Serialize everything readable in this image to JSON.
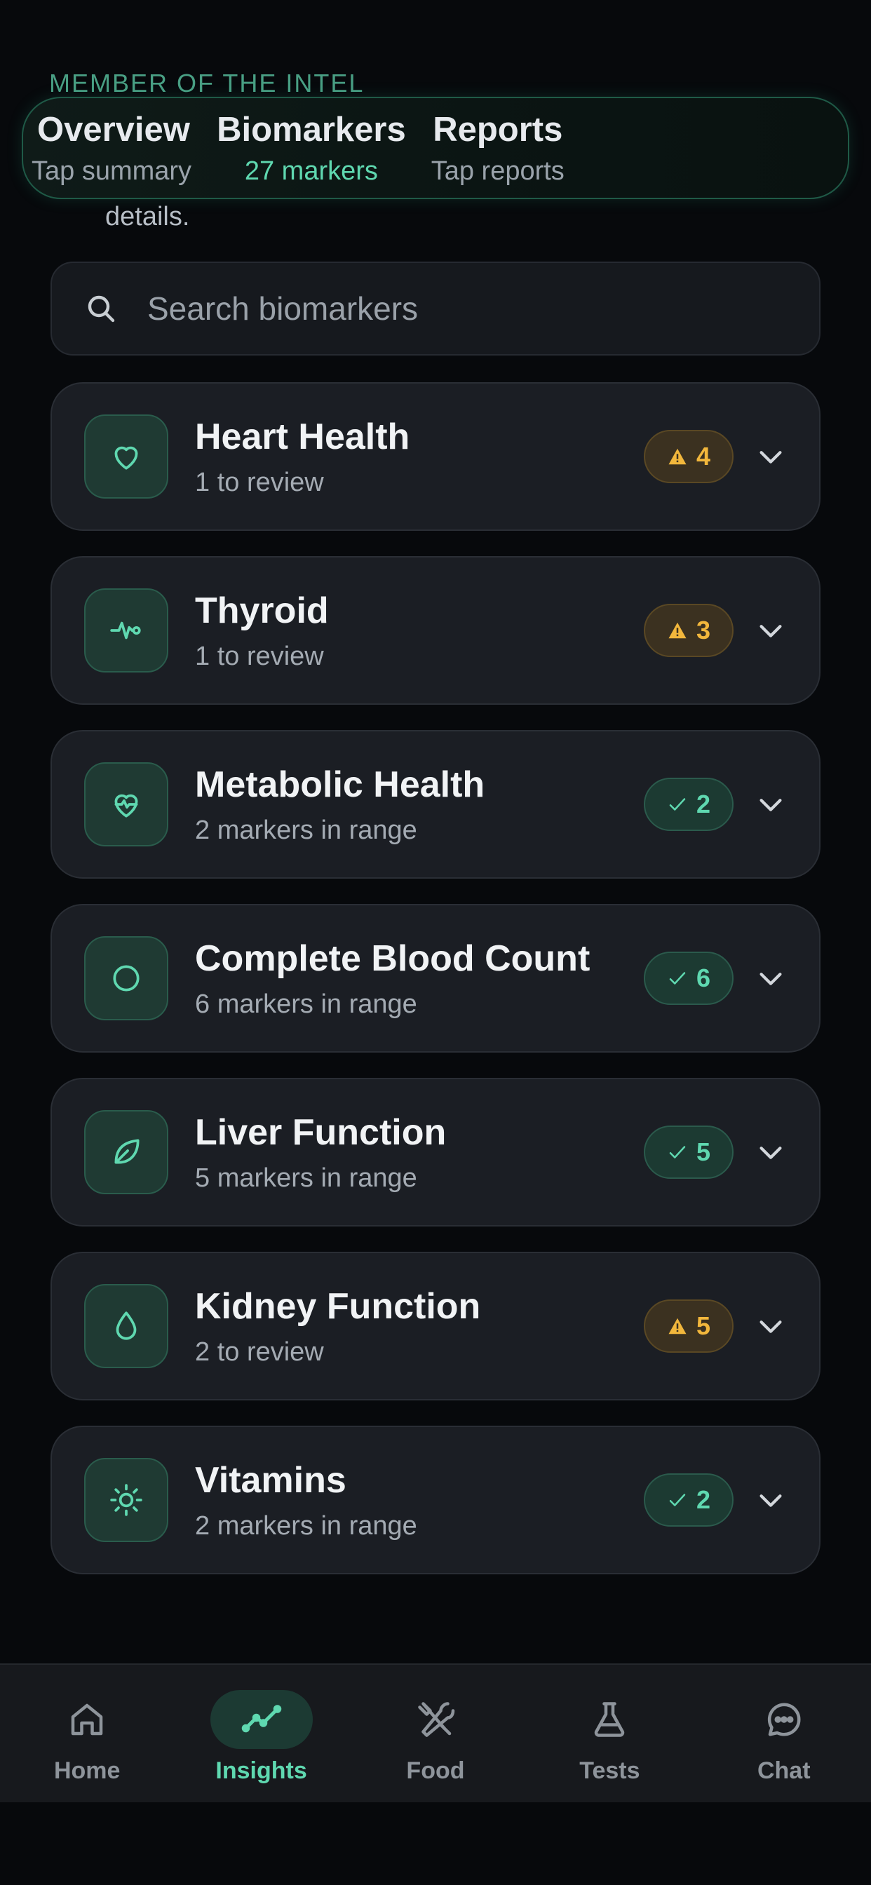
{
  "header": {
    "segments": [
      {
        "title": "Overview",
        "subtitle": "Tap summary"
      },
      {
        "title": "Biomarkers",
        "subtitle": "27 markers"
      },
      {
        "title": "Reports",
        "subtitle": "Tap reports"
      }
    ],
    "active": "Biomarkers"
  },
  "peek": {
    "top_text": "MEMBER OF THE INTEL",
    "details_text": "details."
  },
  "search": {
    "placeholder": "Search biomarkers"
  },
  "categories": [
    {
      "title": "Heart Health",
      "subtitle": "1 to review",
      "badge": "4",
      "status": "warning",
      "icon": "heart-icon"
    },
    {
      "title": "Thyroid",
      "subtitle": "1 to review",
      "badge": "3",
      "status": "warning",
      "icon": "pulse-icon"
    },
    {
      "title": "Metabolic Health",
      "subtitle": "2 markers in range",
      "badge": "2",
      "status": "ok",
      "icon": "heart-pulse-icon"
    },
    {
      "title": "Complete Blood Count",
      "subtitle": "6 markers in range",
      "badge": "6",
      "status": "ok",
      "icon": "circle-icon"
    },
    {
      "title": "Liver Function",
      "subtitle": "5 markers in range",
      "badge": "5",
      "status": "ok",
      "icon": "leaf-icon"
    },
    {
      "title": "Kidney Function",
      "subtitle": "2 to review",
      "badge": "5",
      "status": "warning",
      "icon": "droplet-icon"
    },
    {
      "title": "Vitamins",
      "subtitle": "2 markers in range",
      "badge": "2",
      "status": "ok",
      "icon": "sun-icon"
    }
  ],
  "nav": {
    "items": [
      {
        "label": "Home",
        "icon": "home-icon"
      },
      {
        "label": "Insights",
        "icon": "trend-icon"
      },
      {
        "label": "Food",
        "icon": "utensils-icon"
      },
      {
        "label": "Tests",
        "icon": "flask-icon"
      },
      {
        "label": "Chat",
        "icon": "chat-icon"
      }
    ],
    "active": "Insights"
  },
  "colors": {
    "accent": "#5fd8b0",
    "warning": "#f2b73c",
    "background": "#07090c",
    "card": "#1b1e24"
  }
}
